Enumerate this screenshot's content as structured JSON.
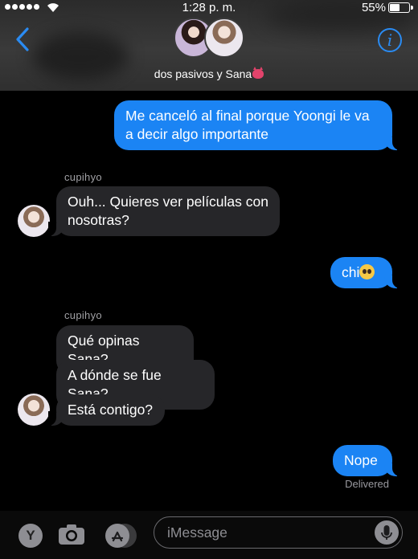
{
  "status_bar": {
    "time": "1:28 p. m.",
    "battery": "55%"
  },
  "header": {
    "group_name": "dos pasivos y Sana"
  },
  "messages": [
    {
      "from": "me",
      "text": "Me canceló al final porque Yoongi le va a decir algo importante"
    },
    {
      "from": "cupihyo",
      "sender": "cupihyo",
      "text": "Ouh... Quieres ver películas con nosotras?"
    },
    {
      "from": "me",
      "text": "chi"
    },
    {
      "from": "cupihyo",
      "sender": "cupihyo",
      "text": "Qué opinas Sana?"
    },
    {
      "from": "cupihyo",
      "text": "A dónde se fue Sana?"
    },
    {
      "from": "cupihyo",
      "text": "Está contigo?"
    },
    {
      "from": "me",
      "text": "Nope",
      "status": "Delivered"
    }
  ],
  "compose": {
    "placeholder": "iMessage",
    "y_label": "Y"
  },
  "icons": [
    "signal-icon",
    "wifi-icon",
    "battery-icon",
    "back-chevron-icon",
    "info-icon",
    "camera-icon",
    "app-store-icon",
    "microphone-icon"
  ],
  "colors": {
    "outgoing": "#1b84f4",
    "incoming": "#262629",
    "accent": "#2a8bf2"
  }
}
